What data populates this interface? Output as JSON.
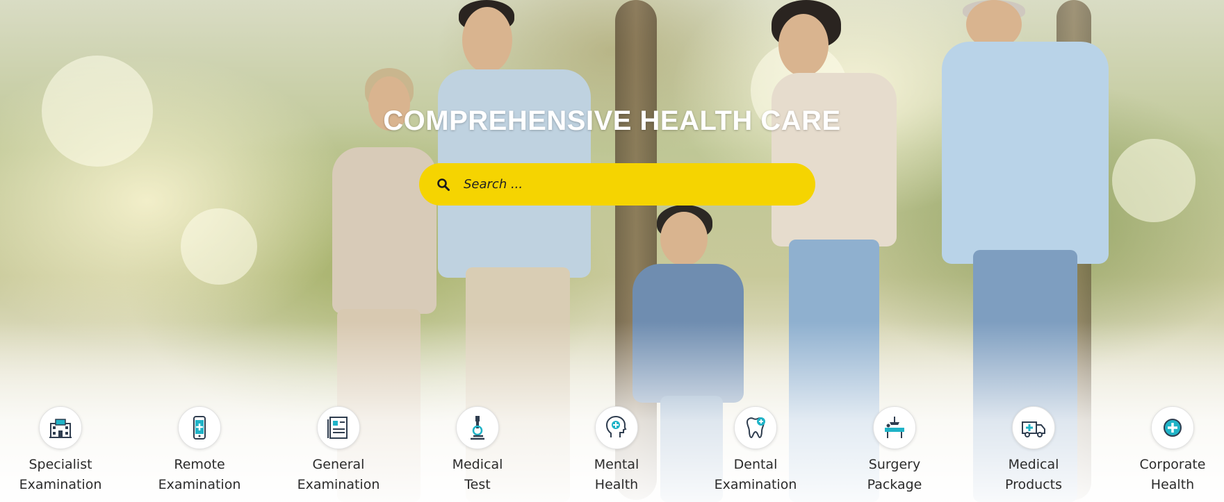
{
  "hero": {
    "headline": "COMPREHENSIVE HEALTH CARE",
    "search": {
      "placeholder": "Search ..."
    }
  },
  "colors": {
    "search_bg": "#f5d401",
    "icon_dark": "#2f3d4f",
    "icon_accent": "#1fb3c7",
    "label_text": "#2b2b2b",
    "headline_text": "#ffffff"
  },
  "services": [
    {
      "line1": "Specialist",
      "line2": "Examination",
      "icon": "hospital-building-icon"
    },
    {
      "line1": "Remote",
      "line2": "Examination",
      "icon": "smartphone-medical-icon"
    },
    {
      "line1": "General",
      "line2": "Examination",
      "icon": "medical-record-icon"
    },
    {
      "line1": "Medical",
      "line2": "Test",
      "icon": "microscope-icon"
    },
    {
      "line1": "Mental",
      "line2": "Health",
      "icon": "head-brain-icon"
    },
    {
      "line1": "Dental",
      "line2": "Examination",
      "icon": "tooth-icon"
    },
    {
      "line1": "Surgery",
      "line2": "Package",
      "icon": "surgery-bed-icon"
    },
    {
      "line1": "Medical",
      "line2": "Products",
      "icon": "ambulance-icon"
    },
    {
      "line1": "Corporate",
      "line2": "Health",
      "icon": "medical-cross-icon"
    }
  ]
}
